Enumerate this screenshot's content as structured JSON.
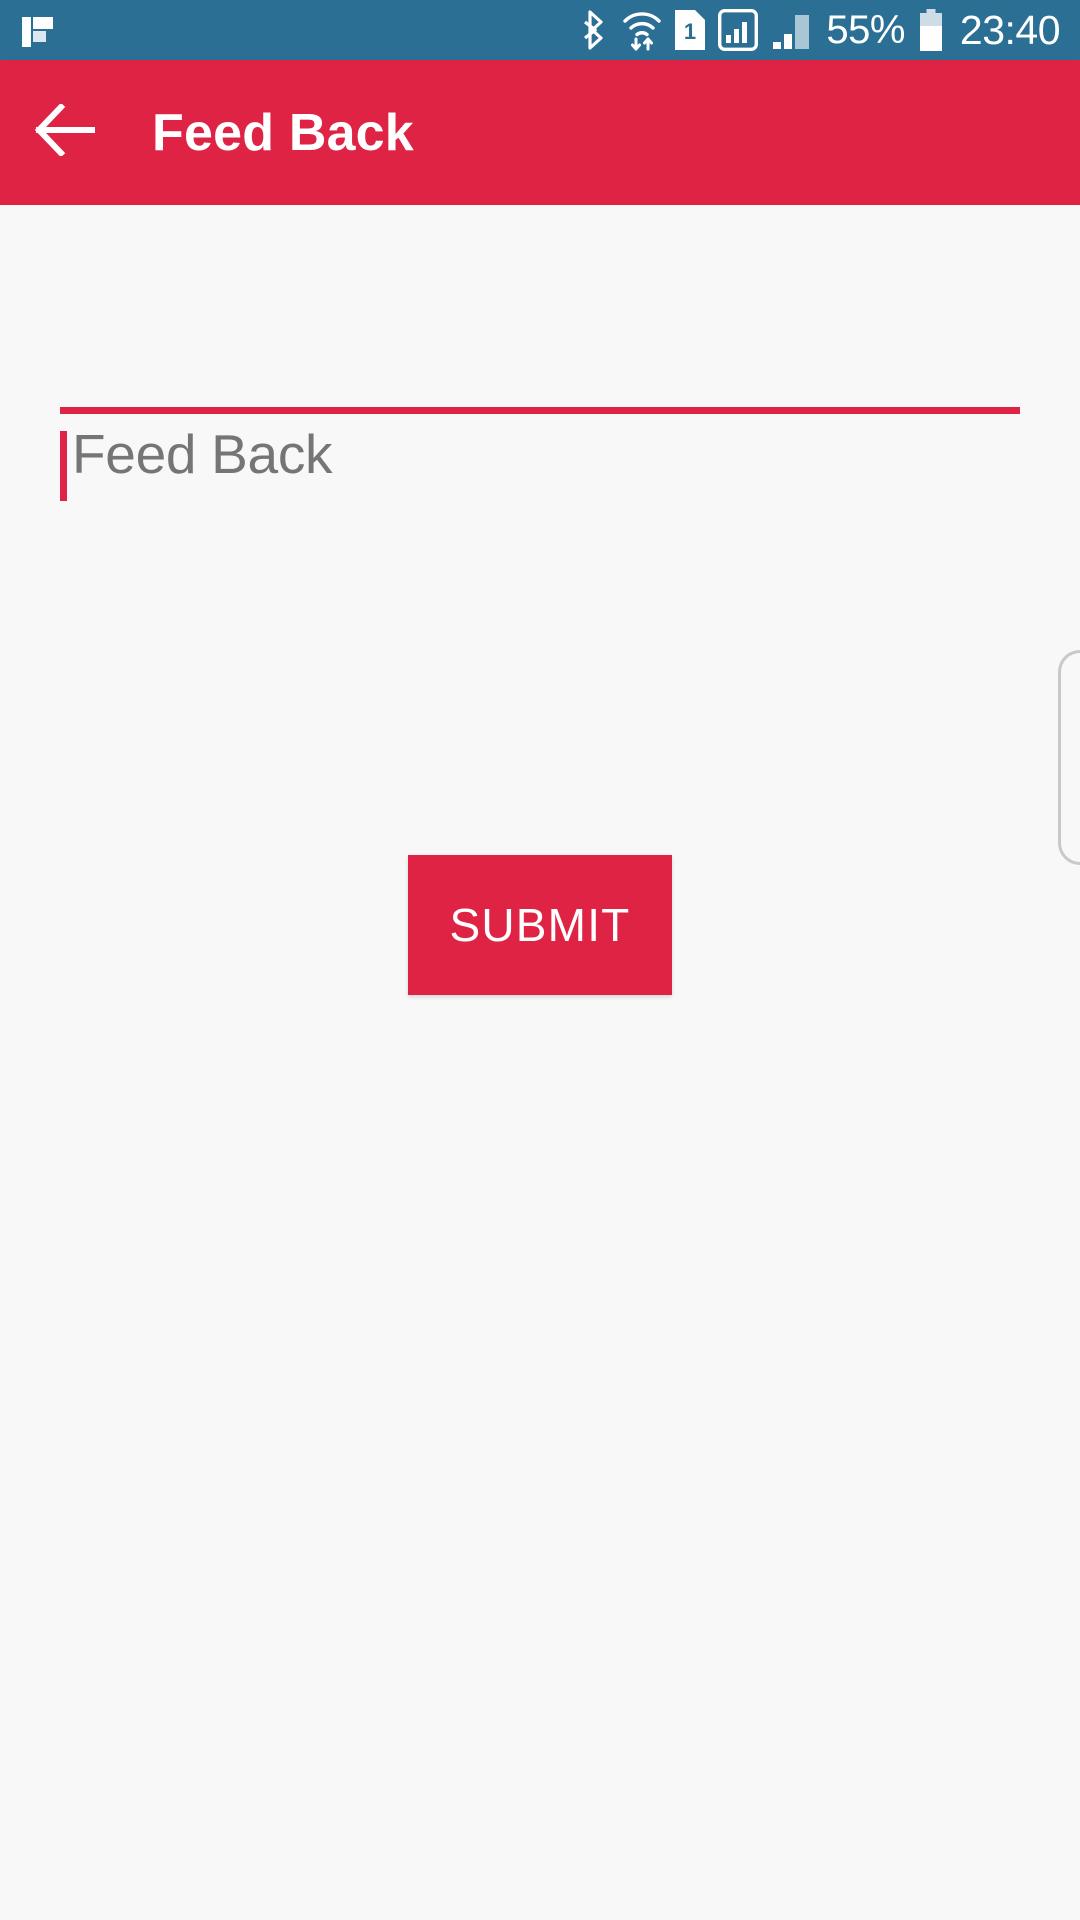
{
  "status_bar": {
    "background_color": "#2b7094",
    "app_logo_icon": "app-logo-icon",
    "icons": [
      {
        "name": "bluetooth-icon",
        "label": "Bluetooth"
      },
      {
        "name": "wifi-transfer-icon",
        "label": "Wi-Fi data transfer"
      },
      {
        "name": "sim-card-1-icon",
        "label": "SIM 1",
        "badge": "1"
      },
      {
        "name": "signal-boxed-icon",
        "label": "Signal strength SIM 1"
      },
      {
        "name": "signal-bars-icon",
        "label": "Signal strength SIM 2"
      }
    ],
    "battery_percent": "55%",
    "battery_icon": "battery-icon",
    "time": "23:40"
  },
  "app_bar": {
    "background_color": "#de2345",
    "back_icon": "back-arrow-icon",
    "title": "Feed Back"
  },
  "form": {
    "feedback_field": {
      "value": "",
      "placeholder": "Feed Back",
      "caret_color": "#de2345",
      "underline_color": "#de2345",
      "placeholder_color": "#757575"
    },
    "submit_button": {
      "label": "SUBMIT",
      "background_color": "#de2345",
      "text_color": "#ffffff"
    }
  },
  "scrollbar": {
    "name": "vertical-scrollbar",
    "color": "#c9c9c9"
  },
  "page": {
    "background_color": "#f8f8f8"
  }
}
